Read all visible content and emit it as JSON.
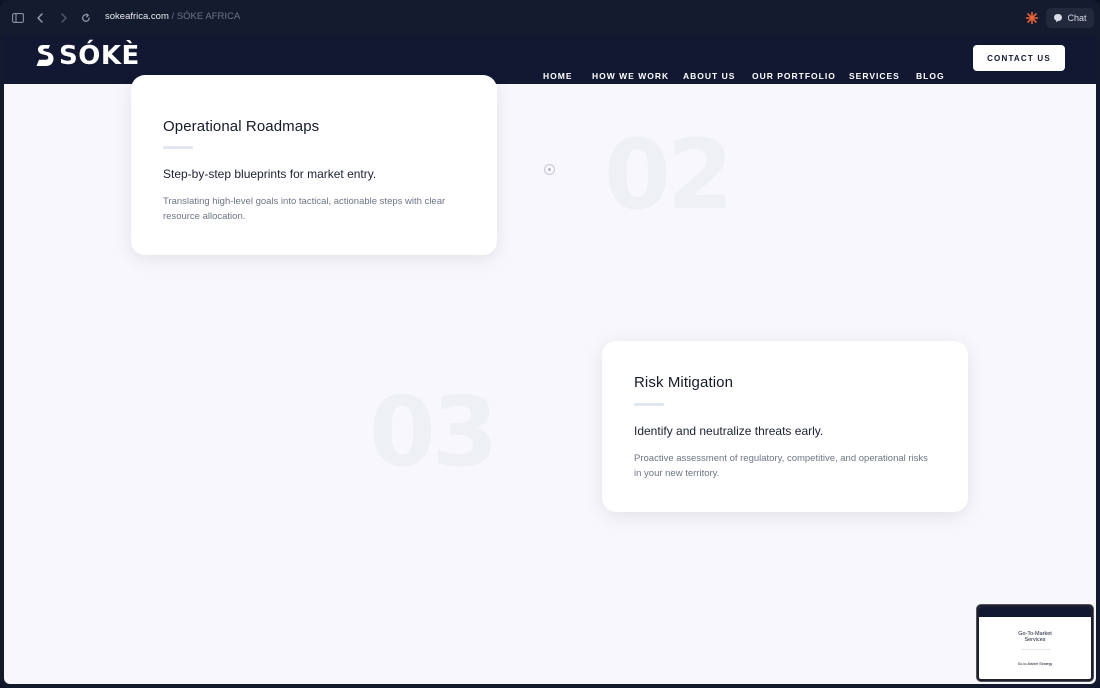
{
  "browser": {
    "domain": "sokeafrica.com",
    "separator": " / ",
    "page_title": "SÓKE AFRICA",
    "chat_label": "Chat"
  },
  "site": {
    "logo_text": "SÓKÈ",
    "nav": [
      "HOME",
      "HOW WE WORK",
      "ABOUT US",
      "OUR PORTFOLIO",
      "SERVICES",
      "BLOG"
    ],
    "contact_label": "CONTACT US"
  },
  "steps": [
    {
      "number": "02",
      "title": "Operational Roadmaps",
      "subtitle": "Step-by-step blueprints for market entry.",
      "description": "Translating high-level goals into tactical, actionable steps with clear resource allocation."
    },
    {
      "number": "03",
      "title": "Risk Mitigation",
      "subtitle": "Identify and neutralize threats early.",
      "description": "Proactive assessment of regulatory, competitive, and operational risks in your new territory."
    }
  ],
  "thumbnail": {
    "heading": "Go-To-Market Services",
    "caption": "Go-to-Market Strategy"
  },
  "colors": {
    "navy": "#121831",
    "page_bg": "#f8f8fc",
    "ghost_number": "#eef0f5",
    "accent_ext": "#e8623a"
  }
}
